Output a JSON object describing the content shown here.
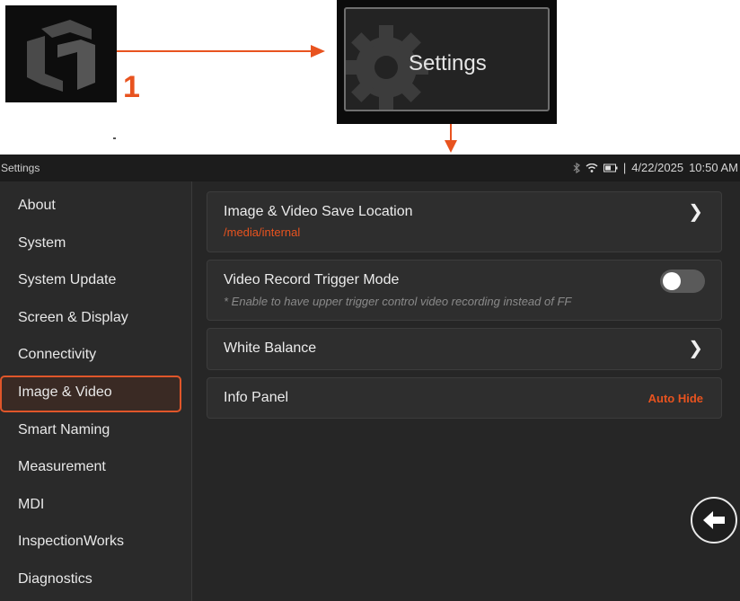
{
  "callout": {
    "step_number": "1",
    "settings_label": "Settings"
  },
  "status_bar": {
    "title": "Settings",
    "date": "4/22/2025",
    "time": "10:50 AM",
    "separator": "|"
  },
  "sidebar": {
    "items": [
      {
        "label": "About"
      },
      {
        "label": "System"
      },
      {
        "label": "System Update"
      },
      {
        "label": "Screen & Display"
      },
      {
        "label": "Connectivity"
      },
      {
        "label": "Image & Video"
      },
      {
        "label": "Smart Naming"
      },
      {
        "label": "Measurement"
      },
      {
        "label": "MDI"
      },
      {
        "label": "InspectionWorks"
      },
      {
        "label": "Diagnostics"
      }
    ],
    "selected": "Image & Video"
  },
  "settings": {
    "save_location": {
      "title": "Image & Video Save Location",
      "value": "/media/internal"
    },
    "trigger_mode": {
      "title": "Video Record Trigger Mode",
      "note": "* Enable to have upper trigger control video recording instead of FF",
      "enabled": false
    },
    "white_balance": {
      "title": "White Balance"
    },
    "info_panel": {
      "title": "Info Panel",
      "value": "Auto Hide"
    }
  },
  "colors": {
    "accent": "#e8531f",
    "background": "#262626",
    "card": "#2e2e2e"
  }
}
